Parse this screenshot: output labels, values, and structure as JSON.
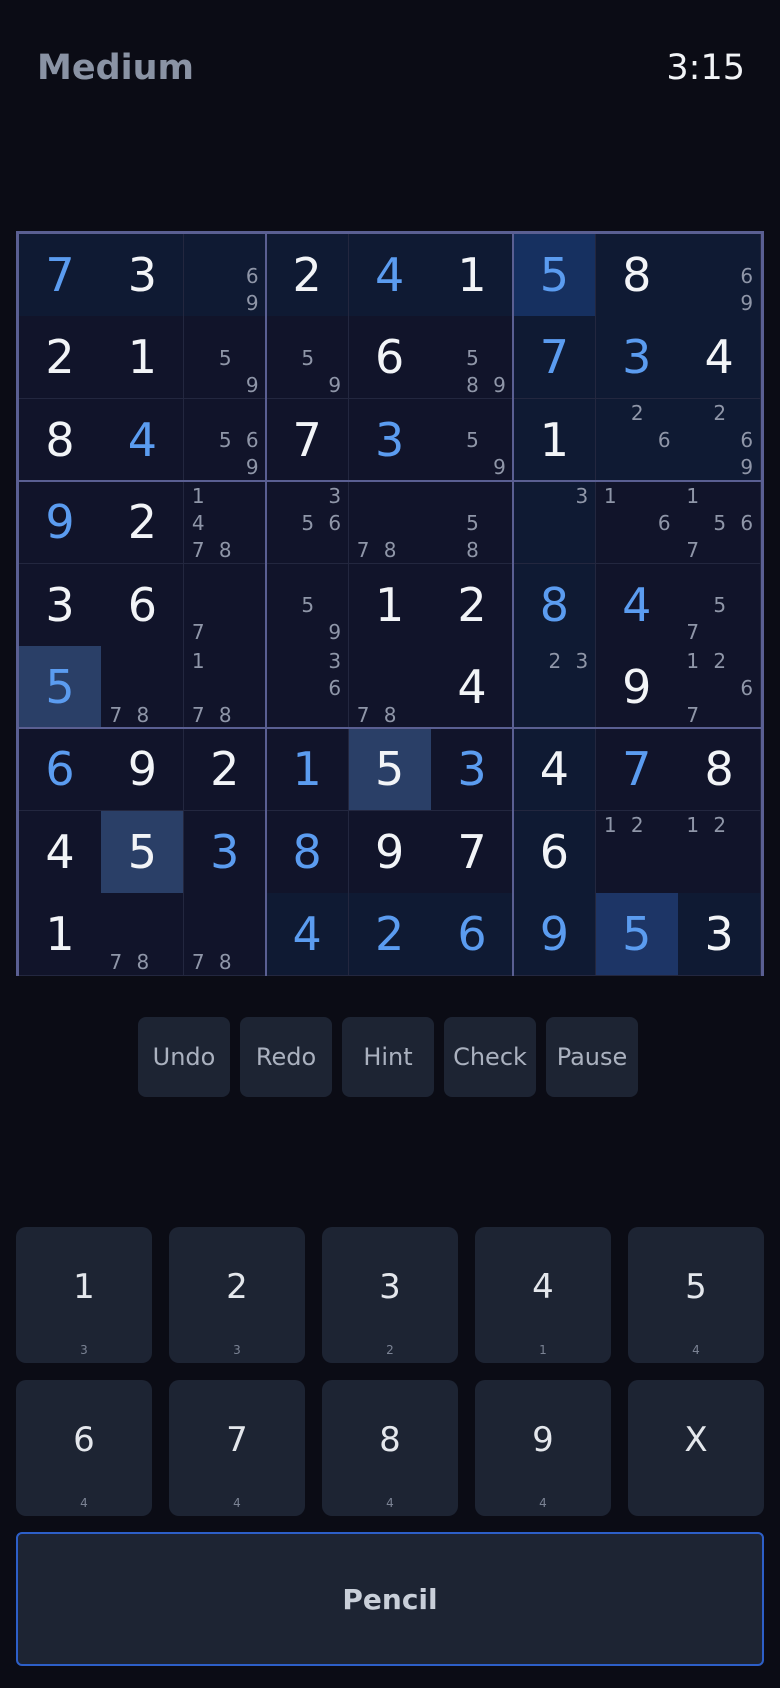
{
  "header": {
    "difficulty": "Medium",
    "timer": "3:15"
  },
  "board": {
    "cells": [
      [
        {
          "v": "7",
          "t": "user",
          "bg": "b"
        },
        {
          "v": "3",
          "t": "given",
          "bg": "b"
        },
        {
          "n": [
            "6",
            "9"
          ],
          "bg": "b"
        },
        {
          "v": "2",
          "t": "given",
          "bg": "b"
        },
        {
          "v": "4",
          "t": "user",
          "bg": "b"
        },
        {
          "v": "1",
          "t": "given",
          "bg": "b"
        },
        {
          "v": "5",
          "t": "user",
          "bg": "c"
        },
        {
          "v": "8",
          "t": "given",
          "bg": "b"
        },
        {
          "n": [
            "6",
            "9"
          ],
          "bg": "b"
        }
      ],
      [
        {
          "v": "2",
          "t": "given",
          "bg": "a"
        },
        {
          "v": "1",
          "t": "given",
          "bg": "a"
        },
        {
          "n": [
            "5",
            "9"
          ],
          "bg": "a"
        },
        {
          "n": [
            "5",
            "9"
          ],
          "bg": "a"
        },
        {
          "v": "6",
          "t": "given",
          "bg": "a"
        },
        {
          "n": [
            "5",
            "8",
            "9"
          ],
          "bg": "a"
        },
        {
          "v": "7",
          "t": "user",
          "bg": "b"
        },
        {
          "v": "3",
          "t": "user",
          "bg": "b"
        },
        {
          "v": "4",
          "t": "given",
          "bg": "b"
        }
      ],
      [
        {
          "v": "8",
          "t": "given",
          "bg": "a"
        },
        {
          "v": "4",
          "t": "user",
          "bg": "a"
        },
        {
          "n": [
            "5",
            "6",
            "9"
          ],
          "bg": "a"
        },
        {
          "v": "7",
          "t": "given",
          "bg": "a"
        },
        {
          "v": "3",
          "t": "user",
          "bg": "a"
        },
        {
          "n": [
            "5",
            "9"
          ],
          "bg": "a"
        },
        {
          "v": "1",
          "t": "given",
          "bg": "b"
        },
        {
          "n": [
            "2",
            "6"
          ],
          "bg": "b"
        },
        {
          "n": [
            "2",
            "6",
            "9"
          ],
          "bg": "b"
        }
      ],
      [
        {
          "v": "9",
          "t": "user",
          "bg": "a"
        },
        {
          "v": "2",
          "t": "given",
          "bg": "a"
        },
        {
          "n": [
            "1",
            "4",
            "7",
            "8"
          ],
          "bg": "a"
        },
        {
          "n": [
            "3",
            "5",
            "6"
          ],
          "bg": "a"
        },
        {
          "n": [
            "7",
            "8"
          ],
          "bg": "a"
        },
        {
          "n": [
            "5",
            "8"
          ],
          "bg": "a"
        },
        {
          "n": [
            "3"
          ],
          "bg": "b"
        },
        {
          "n": [
            "1",
            "6"
          ],
          "bg": "a"
        },
        {
          "n": [
            "1",
            "5",
            "6",
            "7"
          ],
          "bg": "a"
        }
      ],
      [
        {
          "v": "3",
          "t": "given",
          "bg": "a"
        },
        {
          "v": "6",
          "t": "given",
          "bg": "a"
        },
        {
          "n": [
            "7"
          ],
          "bg": "a"
        },
        {
          "n": [
            "5",
            "9"
          ],
          "bg": "a"
        },
        {
          "v": "1",
          "t": "given",
          "bg": "a"
        },
        {
          "v": "2",
          "t": "given",
          "bg": "a"
        },
        {
          "v": "8",
          "t": "user",
          "bg": "b"
        },
        {
          "v": "4",
          "t": "user",
          "bg": "a"
        },
        {
          "n": [
            "5",
            "7"
          ],
          "bg": "a"
        }
      ],
      [
        {
          "v": "5",
          "t": "user",
          "bg": "d"
        },
        {
          "n": [
            "7",
            "8"
          ],
          "bg": "a"
        },
        {
          "n": [
            "1",
            "7",
            "8"
          ],
          "bg": "a"
        },
        {
          "n": [
            "3",
            "6"
          ],
          "bg": "a"
        },
        {
          "n": [
            "7",
            "8"
          ],
          "bg": "a"
        },
        {
          "v": "4",
          "t": "given",
          "bg": "a"
        },
        {
          "n": [
            "2",
            "3"
          ],
          "bg": "b"
        },
        {
          "v": "9",
          "t": "given",
          "bg": "a"
        },
        {
          "n": [
            "1",
            "2",
            "6",
            "7"
          ],
          "bg": "a"
        }
      ],
      [
        {
          "v": "6",
          "t": "user",
          "bg": "a"
        },
        {
          "v": "9",
          "t": "given",
          "bg": "a"
        },
        {
          "v": "2",
          "t": "given",
          "bg": "a"
        },
        {
          "v": "1",
          "t": "user",
          "bg": "a"
        },
        {
          "v": "5",
          "t": "given",
          "bg": "d"
        },
        {
          "v": "3",
          "t": "user",
          "bg": "a"
        },
        {
          "v": "4",
          "t": "given",
          "bg": "b"
        },
        {
          "v": "7",
          "t": "user",
          "bg": "a"
        },
        {
          "v": "8",
          "t": "given",
          "bg": "a"
        }
      ],
      [
        {
          "v": "4",
          "t": "given",
          "bg": "a"
        },
        {
          "v": "5",
          "t": "given",
          "bg": "d"
        },
        {
          "v": "3",
          "t": "user",
          "bg": "a"
        },
        {
          "v": "8",
          "t": "user",
          "bg": "a"
        },
        {
          "v": "9",
          "t": "given",
          "bg": "a"
        },
        {
          "v": "7",
          "t": "given",
          "bg": "a"
        },
        {
          "v": "6",
          "t": "given",
          "bg": "b"
        },
        {
          "n": [
            "1",
            "2"
          ],
          "bg": "a"
        },
        {
          "n": [
            "1",
            "2"
          ],
          "bg": "a"
        }
      ],
      [
        {
          "v": "1",
          "t": "given",
          "bg": "a"
        },
        {
          "n": [
            "7",
            "8"
          ],
          "bg": "a"
        },
        {
          "n": [
            "7",
            "8"
          ],
          "bg": "a"
        },
        {
          "v": "4",
          "t": "user",
          "bg": "b"
        },
        {
          "v": "2",
          "t": "user",
          "bg": "b"
        },
        {
          "v": "6",
          "t": "user",
          "bg": "b"
        },
        {
          "v": "9",
          "t": "user",
          "bg": "b"
        },
        {
          "v": "5",
          "t": "user",
          "bg": "e"
        },
        {
          "v": "3",
          "t": "given",
          "bg": "b"
        }
      ]
    ]
  },
  "actions": [
    {
      "label": "Undo",
      "name": "undo-button"
    },
    {
      "label": "Redo",
      "name": "redo-button"
    },
    {
      "label": "Hint",
      "name": "hint-button"
    },
    {
      "label": "Check",
      "name": "check-button"
    },
    {
      "label": "Pause",
      "name": "pause-button"
    }
  ],
  "keypad": [
    {
      "digit": "1",
      "count": "3"
    },
    {
      "digit": "2",
      "count": "3"
    },
    {
      "digit": "3",
      "count": "2"
    },
    {
      "digit": "4",
      "count": "1"
    },
    {
      "digit": "5",
      "count": "4"
    },
    {
      "digit": "6",
      "count": "4"
    },
    {
      "digit": "7",
      "count": "4"
    },
    {
      "digit": "8",
      "count": "4"
    },
    {
      "digit": "9",
      "count": "4"
    },
    {
      "digit": "X",
      "count": ""
    }
  ],
  "pencil_label": "Pencil",
  "colors": {
    "background": "#0b0c15",
    "given_digit": "#f2f4f7",
    "user_digit": "#5b9cf0",
    "selected_cell": "#163060",
    "same_digit_cell": "#2a3f67",
    "pencil_border": "#2d5fc8"
  }
}
